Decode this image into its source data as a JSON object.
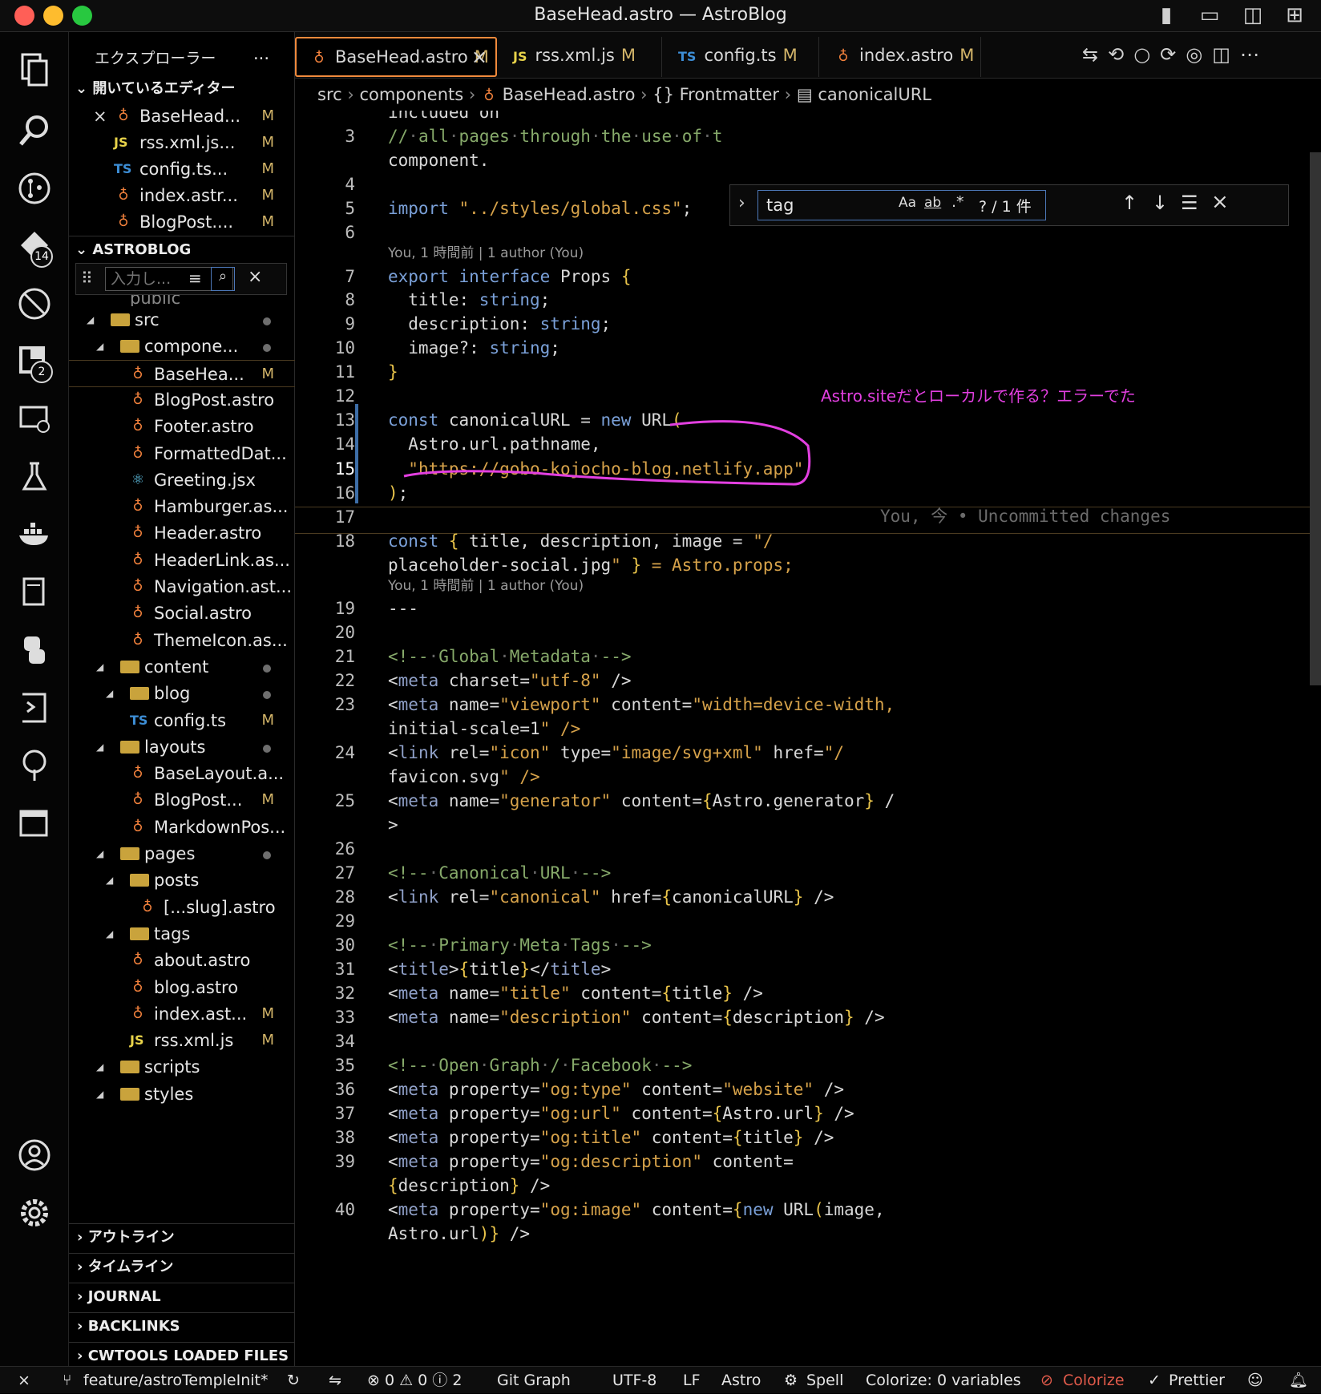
{
  "window": {
    "title": "BaseHead.astro — AstroBlog"
  },
  "colors": {
    "accent": "#f08a3c",
    "modified": "#d2b469",
    "annotation": "#e23fe0",
    "bg": "#000000"
  },
  "activity_badges": {
    "source_control": "14",
    "extensions": "2"
  },
  "sidebar": {
    "title": "エクスプローラー",
    "more": "···",
    "open_editors_title": "開いているエディター",
    "open_editors": [
      {
        "name": "BaseHead...",
        "type": "astro",
        "status": "M"
      },
      {
        "name": "rss.xml.js...",
        "type": "js",
        "status": "M"
      },
      {
        "name": "config.ts...",
        "type": "ts",
        "status": "M"
      },
      {
        "name": "index.astr...",
        "type": "astro",
        "status": "M"
      },
      {
        "name": "BlogPost....",
        "type": "astro",
        "status": "M"
      }
    ],
    "project_title": "ASTROBLOG",
    "filter_placeholder": "入力し...",
    "tree_partial": "public",
    "tree": [
      {
        "name": "src",
        "type": "folder",
        "status": "dot"
      },
      {
        "name": "compone...",
        "type": "folder",
        "status": "dot"
      },
      {
        "name": "BaseHea...",
        "type": "astro",
        "status": "M"
      },
      {
        "name": "BlogPost.astro",
        "type": "astro",
        "status": ""
      },
      {
        "name": "Footer.astro",
        "type": "astro",
        "status": ""
      },
      {
        "name": "FormattedDat...",
        "type": "astro",
        "status": ""
      },
      {
        "name": "Greeting.jsx",
        "type": "react",
        "status": ""
      },
      {
        "name": "Hamburger.as...",
        "type": "astro",
        "status": ""
      },
      {
        "name": "Header.astro",
        "type": "astro",
        "status": ""
      },
      {
        "name": "HeaderLink.as...",
        "type": "astro",
        "status": ""
      },
      {
        "name": "Navigation.ast...",
        "type": "astro",
        "status": ""
      },
      {
        "name": "Social.astro",
        "type": "astro",
        "status": ""
      },
      {
        "name": "ThemeIcon.as...",
        "type": "astro",
        "status": ""
      },
      {
        "name": "content",
        "type": "folder",
        "status": "dot"
      },
      {
        "name": "blog",
        "type": "folder",
        "status": "dot"
      },
      {
        "name": "config.ts",
        "type": "ts",
        "status": "M"
      },
      {
        "name": "layouts",
        "type": "folder",
        "status": "dot"
      },
      {
        "name": "BaseLayout.a...",
        "type": "astro",
        "status": ""
      },
      {
        "name": "BlogPost...",
        "type": "astro",
        "status": "M"
      },
      {
        "name": "MarkdownPos...",
        "type": "astro",
        "status": ""
      },
      {
        "name": "pages",
        "type": "folder",
        "status": "dot"
      },
      {
        "name": "posts",
        "type": "folder",
        "status": ""
      },
      {
        "name": "[...slug].astro",
        "type": "astro",
        "status": ""
      },
      {
        "name": "tags",
        "type": "folder",
        "status": ""
      },
      {
        "name": "about.astro",
        "type": "astro",
        "status": ""
      },
      {
        "name": "blog.astro",
        "type": "astro",
        "status": ""
      },
      {
        "name": "index.ast...",
        "type": "astro",
        "status": "M"
      },
      {
        "name": "rss.xml.js",
        "type": "js",
        "status": "M"
      },
      {
        "name": "scripts",
        "type": "folder",
        "status": ""
      },
      {
        "name": "styles",
        "type": "folder",
        "status": ""
      }
    ],
    "sections": [
      "アウトライン",
      "タイムライン",
      "JOURNAL",
      "BACKLINKS",
      "CWTOOLS LOADED FILES"
    ]
  },
  "tabs": [
    {
      "prefix": "",
      "label": "BaseHead.astro",
      "status": "M",
      "close": "×"
    },
    {
      "prefix": "JS",
      "label": "rss.xml.js",
      "status": "M"
    },
    {
      "prefix": "TS",
      "label": "config.ts",
      "status": "M"
    },
    {
      "prefix": "",
      "label": "index.astro",
      "status": "M"
    }
  ],
  "breadcrumbs": {
    "src": "src",
    "components": "components",
    "file": "BaseHead.astro",
    "frontmatter": "{} Frontmatter",
    "symbol": "canonicalURL"
  },
  "find": {
    "query": "tag",
    "case": "Aa",
    "word": "ab",
    "regex": ".*",
    "result": "? / 1 件"
  },
  "blame": {
    "line7": "You, 1 時間前 | 1 author (You)",
    "line19": "You, 1 時間前 | 1 author (You)",
    "inline15": "You, 今 • Uncommitted changes"
  },
  "annotation": {
    "note": "Astro.siteだとローカルで作る？エラーでた"
  },
  "code_lines": [
    {
      "n": "",
      "text": "included on",
      "cut": true
    },
    {
      "n": "3",
      "text": "// all pages through the use of t"
    },
    {
      "n": "",
      "text": "component."
    },
    {
      "n": "4",
      "text": ""
    },
    {
      "n": "5",
      "text": "import \"../styles/global.css\";"
    },
    {
      "n": "6",
      "text": ""
    },
    {
      "n": "7",
      "text": "export interface Props {"
    },
    {
      "n": "8",
      "text": "  title: string;"
    },
    {
      "n": "9",
      "text": "  description: string;"
    },
    {
      "n": "10",
      "text": "  image?: string;"
    },
    {
      "n": "11",
      "text": "}"
    },
    {
      "n": "12",
      "text": ""
    },
    {
      "n": "13",
      "text": "const canonicalURL = new URL("
    },
    {
      "n": "14",
      "text": "  Astro.url.pathname,"
    },
    {
      "n": "15",
      "text": "  \"https://gobo-kojocho-blog.netlify.app\""
    },
    {
      "n": "16",
      "text": ");"
    },
    {
      "n": "17",
      "text": ""
    },
    {
      "n": "18",
      "text": "const { title, description, image = \"/"
    },
    {
      "n": "",
      "text": "placeholder-social.jpg\" } = Astro.props;"
    },
    {
      "n": "19",
      "text": "---"
    },
    {
      "n": "20",
      "text": ""
    },
    {
      "n": "21",
      "text": "<!-- Global Metadata -->"
    },
    {
      "n": "22",
      "text": "<meta charset=\"utf-8\" />"
    },
    {
      "n": "23",
      "text": "<meta name=\"viewport\" content=\"width=device-width,"
    },
    {
      "n": "",
      "text": "initial-scale=1\" />"
    },
    {
      "n": "24",
      "text": "<link rel=\"icon\" type=\"image/svg+xml\" href=\"/"
    },
    {
      "n": "",
      "text": "favicon.svg\" />"
    },
    {
      "n": "25",
      "text": "<meta name=\"generator\" content={Astro.generator} /"
    },
    {
      "n": "",
      "text": ">"
    },
    {
      "n": "26",
      "text": ""
    },
    {
      "n": "27",
      "text": "<!-- Canonical URL -->"
    },
    {
      "n": "28",
      "text": "<link rel=\"canonical\" href={canonicalURL} />"
    },
    {
      "n": "29",
      "text": ""
    },
    {
      "n": "30",
      "text": "<!-- Primary Meta Tags -->"
    },
    {
      "n": "31",
      "text": "<title>{title}</title>"
    },
    {
      "n": "32",
      "text": "<meta name=\"title\" content={title} />"
    },
    {
      "n": "33",
      "text": "<meta name=\"description\" content={description} />"
    },
    {
      "n": "34",
      "text": ""
    },
    {
      "n": "35",
      "text": "<!-- Open Graph / Facebook -->"
    },
    {
      "n": "36",
      "text": "<meta property=\"og:type\" content=\"website\" />"
    },
    {
      "n": "37",
      "text": "<meta property=\"og:url\" content={Astro.url} />"
    },
    {
      "n": "38",
      "text": "<meta property=\"og:title\" content={title} />"
    },
    {
      "n": "39",
      "text": "<meta property=\"og:description\" content="
    },
    {
      "n": "",
      "text": "{description} />"
    },
    {
      "n": "40",
      "text": "<meta property=\"og:image\" content={new URL(image, "
    },
    {
      "n": "",
      "text": "Astro.url)} />"
    }
  ],
  "status": {
    "branch": "feature/astroTempleInit*",
    "problems": "⊗ 0 ⚠ 0 ⓘ 2",
    "git_graph": "Git Graph",
    "encoding": "UTF-8",
    "eol": "LF",
    "language": "Astro",
    "spell": "Spell",
    "colorize_vars": "Colorize: 0 variables",
    "colorize": "Colorize",
    "prettier": "Prettier"
  }
}
